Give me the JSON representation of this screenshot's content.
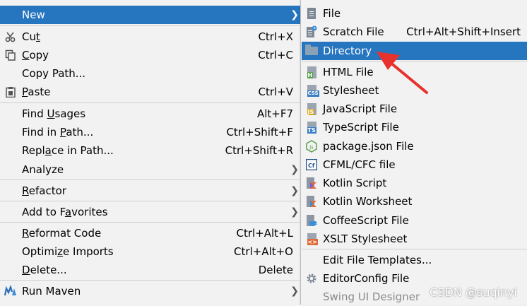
{
  "main_menu": {
    "items": [
      {
        "label": "New",
        "has_submenu": true,
        "selected": true
      },
      {
        "label_pre": "Cu",
        "label_u": "t",
        "label_post": "",
        "shortcut": "Ctrl+X",
        "icon": "scissors-icon"
      },
      {
        "label_pre": "",
        "label_u": "C",
        "label_post": "opy",
        "shortcut": "Ctrl+C",
        "icon": "copy-icon"
      },
      {
        "label": "Copy Path...",
        "shortcut": ""
      },
      {
        "label_pre": "",
        "label_u": "P",
        "label_post": "aste",
        "shortcut": "Ctrl+V",
        "icon": "clipboard-icon"
      },
      {
        "label_pre": "Find ",
        "label_u": "U",
        "label_post": "sages",
        "shortcut": "Alt+F7"
      },
      {
        "label_pre": "Find in ",
        "label_u": "P",
        "label_post": "ath...",
        "shortcut": "Ctrl+Shift+F"
      },
      {
        "label_pre": "Repl",
        "label_u": "a",
        "label_post": "ce in Path...",
        "shortcut": "Ctrl+Shift+R"
      },
      {
        "label": "Analyze",
        "has_submenu": true
      },
      {
        "label_pre": "",
        "label_u": "R",
        "label_post": "efactor",
        "has_submenu": true
      },
      {
        "label_pre": "Add to F",
        "label_u": "a",
        "label_post": "vorites",
        "has_submenu": true
      },
      {
        "label_pre": "",
        "label_u": "R",
        "label_post": "eformat Code",
        "shortcut": "Ctrl+Alt+L"
      },
      {
        "label_pre": "Optimi",
        "label_u": "z",
        "label_post": "e Imports",
        "shortcut": "Ctrl+Alt+O"
      },
      {
        "label_pre": "",
        "label_u": "D",
        "label_post": "elete...",
        "shortcut": "Delete"
      },
      {
        "label": "Run Maven",
        "has_submenu": true,
        "icon": "maven-icon"
      }
    ]
  },
  "sub_menu": {
    "items": [
      {
        "label": "File",
        "icon": "file-icon"
      },
      {
        "label": "Scratch File",
        "shortcut": "Ctrl+Alt+Shift+Insert",
        "icon": "scratch-file-icon"
      },
      {
        "label": "Directory",
        "icon": "folder-icon",
        "selected": true
      },
      {
        "label": "HTML File",
        "icon": "html-file-icon",
        "badge": "H"
      },
      {
        "label": "Stylesheet",
        "icon": "css-file-icon",
        "badge": "CSS"
      },
      {
        "label": "JavaScript File",
        "icon": "javascript-file-icon",
        "badge": "JS"
      },
      {
        "label": "TypeScript File",
        "icon": "typescript-file-icon",
        "badge": "TS"
      },
      {
        "label": "package.json File",
        "icon": "nodejs-icon"
      },
      {
        "label": "CFML/CFC file",
        "icon": "cfml-icon",
        "badge": "Cf"
      },
      {
        "label": "Kotlin Script",
        "icon": "kotlin-script-icon"
      },
      {
        "label": "Kotlin Worksheet",
        "icon": "kotlin-worksheet-icon"
      },
      {
        "label": "CoffeeScript File",
        "icon": "coffeescript-icon"
      },
      {
        "label": "XSLT Stylesheet",
        "icon": "xslt-icon",
        "badge": "<>"
      },
      {
        "label": "Edit File Templates..."
      },
      {
        "label": "EditorConfig File",
        "icon": "gear-icon"
      },
      {
        "label": "Swing UI Designer",
        "disabled": true
      }
    ]
  },
  "watermark": "CSDN @suqinyi",
  "colors": {
    "menu_bg": "#f2f2f2",
    "selection": "#2675bf",
    "annotation_arrow": "#e8312c"
  }
}
